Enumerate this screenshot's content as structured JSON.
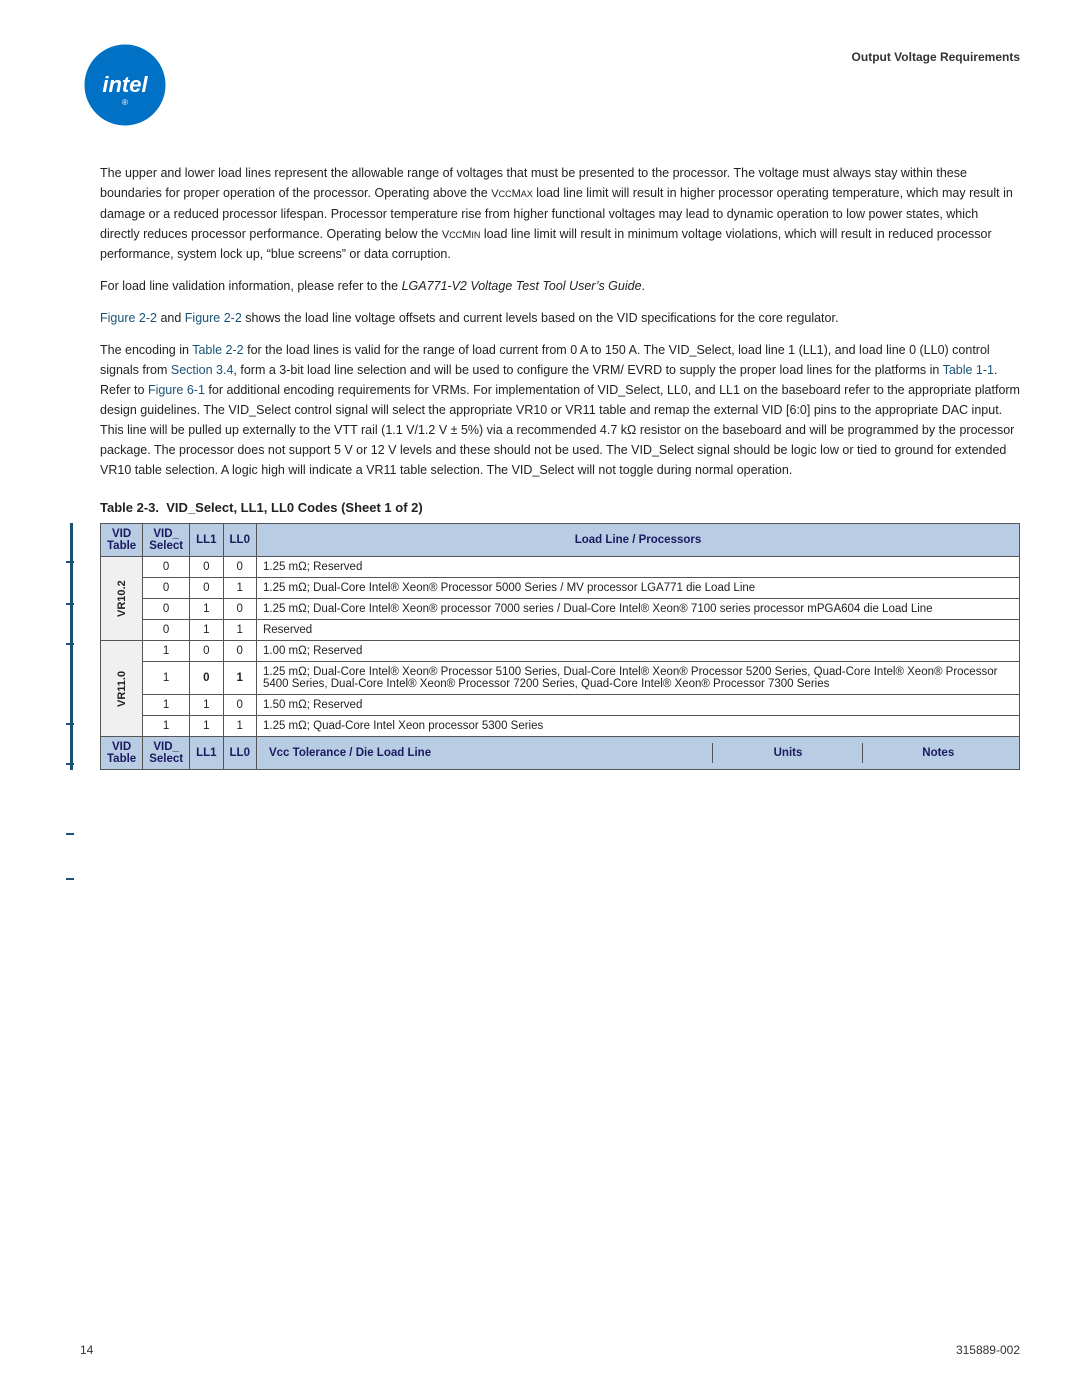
{
  "header": {
    "title": "Output Voltage Requirements",
    "logo_alt": "Intel logo"
  },
  "body_paragraphs": [
    "The upper and lower load lines represent the allowable range of voltages that must be presented to the processor. The voltage must always stay within these boundaries for proper operation of the processor. Operating above the VccMAX load line limit will result in higher processor operating temperature, which may result in damage or a reduced processor lifespan. Processor temperature rise from higher functional voltages may lead to dynamic operation to low power states, which directly reduces processor performance. Operating below the VccMIN load line limit will result in minimum voltage violations, which will result in reduced processor performance, system lock up, “blue screens” or data corruption.",
    "For load line validation information, please refer to the LGA771-V2 Voltage Test Tool User’s Guide.",
    "Figure 2-2 and Figure 2-2 shows the load line voltage offsets and current levels based on the VID specifications for the core regulator.",
    "The encoding in Table 2-2 for the load lines is valid for the range of load current from 0 A to 150 A. The VID_Select, load line 1 (LL1), and load line 0 (LL0) control signals from Section 3.4, form a 3-bit load line selection and will be used to configure the VRM/EVRD to supply the proper load lines for the platforms in Table 1-1. Refer to Figure 6-1 for additional encoding requirements for VRMs. For implementation of VID_Select, LL0, and LL1 on the baseboard refer to the appropriate platform design guidelines. The VID_Select control signal will select the appropriate VR10 or VR11 table and remap the external VID [6:0] pins to the appropriate DAC input. This line will be pulled up externally to the VTT rail (1.1 V/1.2 V ± 5%) via a recommended 4.7 kΩ resistor on the baseboard and will be programmed by the processor package. The processor does not support 5 V or 12 V levels and these should not be used. The VID_Select signal should be logic low or tied to ground for extended VR10 table selection. A logic high will indicate a VR11 table selection. The VID_Select will not toggle during normal operation."
  ],
  "table": {
    "caption_label": "Table 2-3.",
    "caption_title": "VID_Select, LL1, LL0 Codes (Sheet 1 of 2)",
    "headers": [
      "VID Table",
      "VID_ Select",
      "LL1",
      "LL0",
      "Load Line / Processors"
    ],
    "footer_headers": [
      "VID Table",
      "VID_ Select",
      "LL1",
      "LL0",
      "Vcc Tolerance / Die Load Line",
      "Units",
      "Notes"
    ],
    "vr_groups": [
      {
        "label": "VR10.2",
        "rows": [
          {
            "vid_select": "0",
            "ll1": "0",
            "ll0": "0",
            "load_line": "1.25 mΩ; Reserved"
          },
          {
            "vid_select": "0",
            "ll1": "0",
            "ll0": "1",
            "load_line": "1.25 mΩ; Dual-Core Intel® Xeon® Processor 5000 Series / MV processor LGA771 die Load Line"
          },
          {
            "vid_select": "0",
            "ll1": "1",
            "ll0": "0",
            "load_line": "1.25 mΩ; Dual-Core Intel® Xeon® processor 7000 series / Dual-Core Intel® Xeon® 7100 series processor mPGA604 die Load Line"
          },
          {
            "vid_select": "0",
            "ll1": "1",
            "ll0": "1",
            "load_line": "Reserved"
          }
        ]
      },
      {
        "label": "VR11.0",
        "rows": [
          {
            "vid_select": "1",
            "ll1": "0",
            "ll0": "0",
            "load_line": "1.00 mΩ; Reserved"
          },
          {
            "vid_select": "1",
            "ll1": "0",
            "ll0": "1",
            "load_line": "1.25 mΩ; Dual-Core Intel® Xeon® Processor 5100 Series, Dual-Core Intel® Xeon® Processor 5200 Series, Quad-Core Intel® Xeon® Processor 5400 Series, Dual-Core Intel® Xeon® Processor 7200 Series, Quad-Core Intel® Xeon® Processor 7300 Series"
          },
          {
            "vid_select": "1",
            "ll1": "1",
            "ll0": "0",
            "load_line": "1.50 mΩ; Reserved"
          },
          {
            "vid_select": "1",
            "ll1": "1",
            "ll0": "1",
            "load_line": "1.25 mΩ; Quad-Core Intel Xeon processor 5300 Series"
          }
        ]
      }
    ]
  },
  "footer": {
    "page_number": "14",
    "doc_number": "315889-002"
  }
}
